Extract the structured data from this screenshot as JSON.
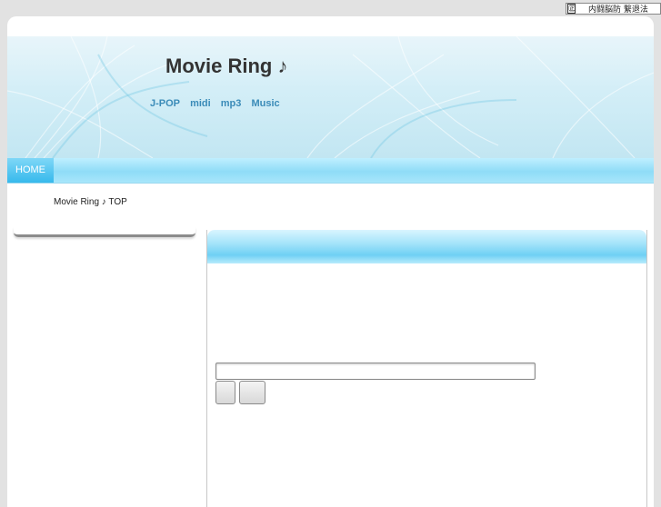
{
  "topbar": {
    "icon_glyph": "㊣",
    "text": "内闘脳防 繋退法"
  },
  "header": {
    "title": "Movie Ring ♪",
    "tagline": [
      "J-POP",
      "midi",
      "mp3",
      "Music"
    ]
  },
  "nav": {
    "items": [
      {
        "label": "HOME"
      }
    ]
  },
  "breadcrumb": "Movie Ring ♪ TOP",
  "search": {
    "value": "",
    "button_1": "",
    "button_2": ""
  },
  "colors": {
    "accent": "#36b9ec",
    "nav_bar": "#8fdcf7",
    "tagline": "#3a8bb8",
    "title": "#333333"
  }
}
